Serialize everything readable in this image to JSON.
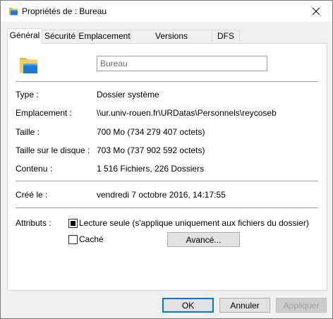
{
  "window": {
    "title": "Propriétés de : Bureau",
    "close_icon": "close-icon"
  },
  "tabs": [
    {
      "label": "Général",
      "active": true
    },
    {
      "label": "Sécurité",
      "active": false
    },
    {
      "label": "Emplacement",
      "active": false
    },
    {
      "label": "Versions précédentes",
      "active": false
    },
    {
      "label": "DFS",
      "active": false
    }
  ],
  "general": {
    "folder_name": "Bureau",
    "type_label": "Type :",
    "type_value": "Dossier système",
    "location_label": "Emplacement :",
    "location_value": "\\\\ur.univ-rouen.fr\\URDatas\\Personnels\\reycoseb",
    "size_label": "Taille :",
    "size_value": "700 Mo (734 279 407 octets)",
    "disk_size_label": "Taille sur le disque :",
    "disk_size_value": "703 Mo (737 902 592 octets)",
    "contents_label": "Contenu :",
    "contents_value": "1 516 Fichiers, 226 Dossiers",
    "created_label": "Créé le :",
    "created_value": "vendredi 7 octobre 2016, 14:17:55",
    "attributes_label": "Attributs :",
    "readonly_label": "Lecture seule (s'applique uniquement aux fichiers du dossier)",
    "readonly_checked": true,
    "hidden_label": "Caché",
    "hidden_checked": false,
    "advanced_button": "Avancé..."
  },
  "buttons": {
    "ok": "OK",
    "cancel": "Annuler",
    "apply": "Appliquer"
  },
  "colors": {
    "folder_yellow": "#f7cf5e",
    "folder_blue": "#1e7bd4",
    "accent": "#0078d7"
  }
}
